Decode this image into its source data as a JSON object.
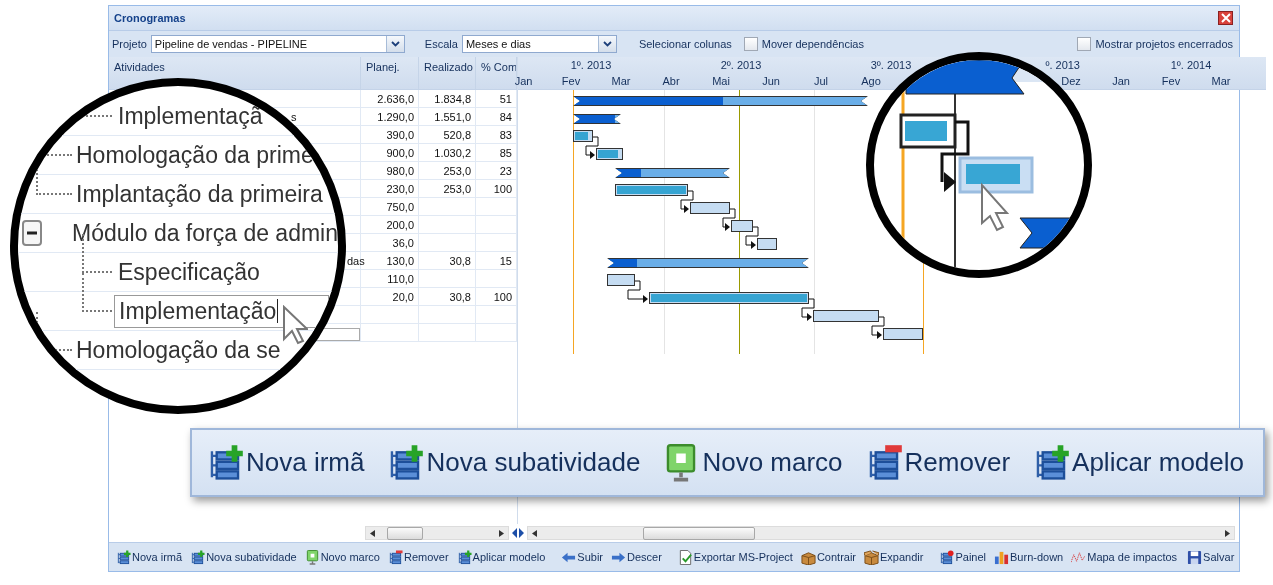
{
  "window": {
    "title": "Cronogramas"
  },
  "toolbar": {
    "project_label": "Projeto",
    "project_value": "Pipeline de vendas - PIPELINE",
    "scale_label": "Escala",
    "scale_value": "Meses e dias",
    "select_columns": "Selecionar colunas",
    "move_dependencies": {
      "label": "Mover dependências",
      "checked": false
    },
    "show_closed": {
      "label": "Mostrar projetos encerrados",
      "checked": false
    }
  },
  "table": {
    "columns": [
      "Atividades",
      "Planej.",
      "Realizado",
      "% Com"
    ],
    "rows": [
      {
        "planned": "2.636,0",
        "actual": "1.834,8",
        "complete": "51",
        "bar": {
          "kind": "summary",
          "level": 0.51
        },
        "linked": false
      },
      {
        "activity": "s",
        "planned": "1.290,0",
        "actual": "1.551,0",
        "complete": "84",
        "bar": {
          "kind": "summary",
          "level": 0.88
        },
        "linked": false
      },
      {
        "planned": "390,0",
        "actual": "520,8",
        "complete": "83",
        "bar": {
          "kind": "task",
          "level": 0.83
        },
        "linked": false
      },
      {
        "planned": "900,0",
        "actual": "1.030,2",
        "complete": "85",
        "bar": {
          "kind": "task",
          "level": 0.85
        },
        "linked": true
      },
      {
        "planned": "980,0",
        "actual": "253,0",
        "complete": "23",
        "bar": {
          "kind": "summary",
          "level": 0.23
        },
        "linked": false
      },
      {
        "planned": "230,0",
        "actual": "253,0",
        "complete": "100",
        "bar": {
          "kind": "task",
          "level": 1
        },
        "linked": false
      },
      {
        "planned": "750,0",
        "bar": {
          "kind": "task",
          "level": 0
        },
        "linked": true
      },
      {
        "planned": "200,0",
        "bar": {
          "kind": "task",
          "level": 0
        },
        "linked": true
      },
      {
        "planned": "36,0",
        "bar": {
          "kind": "task",
          "level": 0
        },
        "linked": true
      },
      {
        "activity": "das",
        "planned": "130,0",
        "actual": "30,8",
        "complete": "15",
        "bar": {
          "kind": "summary",
          "level": 0.15
        },
        "linked": false
      },
      {
        "planned": "110,0",
        "bar": {
          "kind": "task",
          "level": 0
        },
        "linked": false
      },
      {
        "planned": "20,0",
        "actual": "30,8",
        "complete": "100",
        "bar": {
          "kind": "task",
          "level": 1
        },
        "linked": true
      },
      {
        "bar": {
          "kind": "task",
          "level": 0
        },
        "linked": true
      },
      {
        "bar": {
          "kind": "task",
          "level": 0
        },
        "linked": true,
        "editing": true
      }
    ]
  },
  "timeline": {
    "quarters": [
      "1º. 2013",
      "2º. 2013",
      "3º. 2013",
      "º. 2013",
      "1º. 2014"
    ],
    "months_before": [
      "Jan",
      "Fev",
      "Mar",
      "Abr",
      "Mai",
      "Jun",
      "Jul",
      "Ago"
    ],
    "months_after": [
      "Dez",
      "Jan",
      "Fev",
      "Mar"
    ]
  },
  "magnifier": {
    "partial_children": [
      {
        "label": "Implementaçã"
      }
    ],
    "items": [
      {
        "label": "Homologação da prime"
      },
      {
        "label": "Implantação da primeira"
      },
      {
        "label": "Módulo da força de admin",
        "expanded": true,
        "children": [
          {
            "label": "Especificação",
            "editing": false
          },
          {
            "label": "Implementação",
            "editing": true
          }
        ]
      },
      {
        "label": "Homologação da se"
      }
    ]
  },
  "toolbar_zoom": {
    "buttons": [
      "Nova irmã",
      "Nova subatividade",
      "Novo marco",
      "Remover",
      "Aplicar modelo"
    ]
  },
  "bottom_toolbar": {
    "groups": [
      [
        "Nova irmã",
        "Nova subatividade",
        "Novo marco",
        "Remover",
        "Aplicar modelo"
      ],
      [
        "Subir",
        "Descer"
      ],
      [
        "Exportar MS-Project",
        "Contrair",
        "Expandir"
      ],
      [
        "Painel",
        "Burn-down",
        "Mapa de impactos"
      ]
    ],
    "save": "Salvar"
  }
}
